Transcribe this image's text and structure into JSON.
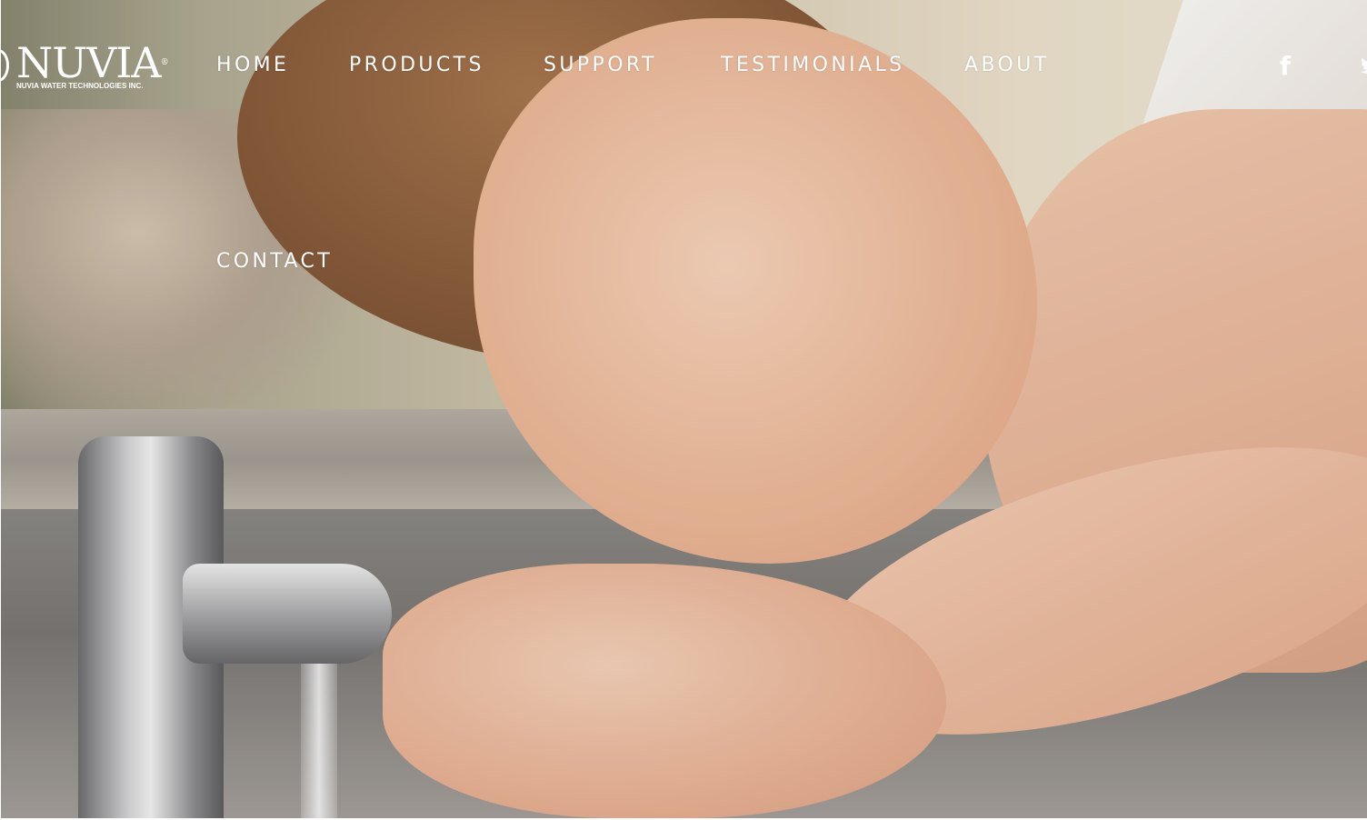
{
  "brand": {
    "name": "NUVIA",
    "trademark": "®",
    "tagline": "NUVIA WATER TECHNOLOGIES INC."
  },
  "nav": {
    "items": [
      {
        "label": "HOME"
      },
      {
        "label": "PRODUCTS"
      },
      {
        "label": "SUPPORT"
      },
      {
        "label": "TESTIMONIALS"
      },
      {
        "label": "ABOUT"
      },
      {
        "label": "CONTACT"
      }
    ]
  },
  "social": {
    "facebook_icon": "facebook-icon",
    "facebook_glyph": "f",
    "twitter_icon": "twitter-icon"
  },
  "colors": {
    "nav_text": "#ffffff"
  }
}
